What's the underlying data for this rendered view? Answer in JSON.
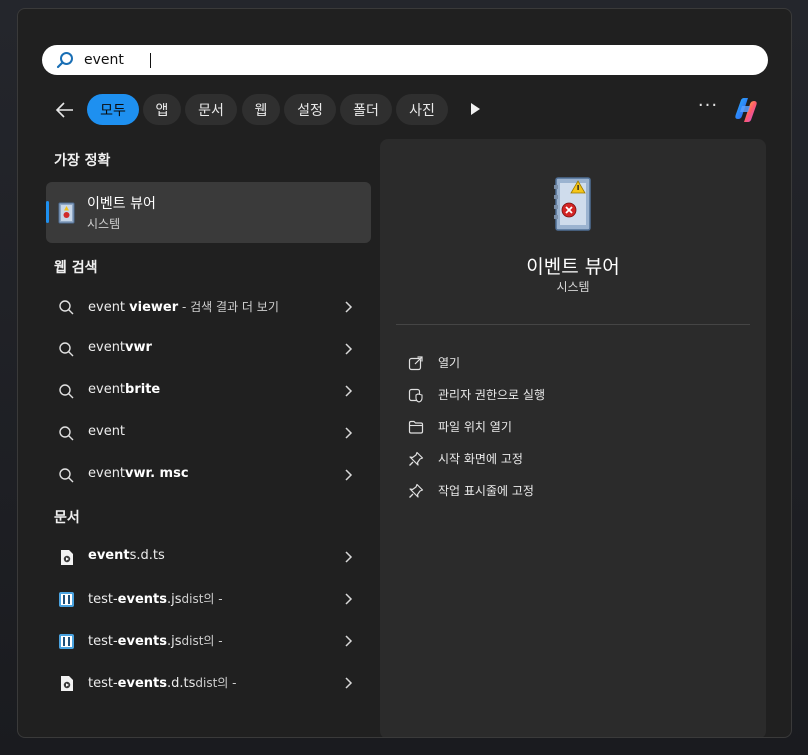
{
  "search": {
    "value": "event"
  },
  "filters": [
    {
      "label": "모두",
      "active": true
    },
    {
      "label": "앱"
    },
    {
      "label": "문서"
    },
    {
      "label": "웹"
    },
    {
      "label": "설정"
    },
    {
      "label": "폴더"
    },
    {
      "label": "사진"
    }
  ],
  "more_label": "···",
  "sections": {
    "best_match": "가장 정확",
    "web": "웹 검색",
    "docs": "문서"
  },
  "best_match": {
    "name": "이벤트 뷰어",
    "subtitle": "시스템"
  },
  "web_results": [
    {
      "plain": "event ",
      "bold": "viewer",
      "suffix": " - 검색 결과 더 보기"
    },
    {
      "plain": "event",
      "bold": "vwr",
      "suffix": ""
    },
    {
      "plain": "event",
      "bold": "brite",
      "suffix": ""
    },
    {
      "plain": "event",
      "bold": "",
      "suffix": ""
    },
    {
      "plain": "event",
      "bold": "vwr. msc",
      "suffix": ""
    }
  ],
  "doc_results": [
    {
      "pre": "",
      "bold": "event",
      "post": "s.d.ts",
      "suffix": "",
      "icon": "ts-file-icon"
    },
    {
      "pre": "test-",
      "bold": "events",
      "post": ".js",
      "suffix": "dist의 -",
      "icon": "js-file-icon"
    },
    {
      "pre": "test-",
      "bold": "events",
      "post": ".js",
      "suffix": "dist의 -",
      "icon": "js-file-icon"
    },
    {
      "pre": "test-",
      "bold": "events",
      "post": ".d.ts",
      "suffix": "dist의 -",
      "icon": "ts-file-icon"
    }
  ],
  "preview": {
    "title": "이벤트 뷰어",
    "subtitle": "시스템",
    "actions": [
      {
        "label": "열기",
        "icon": "open-icon"
      },
      {
        "label": "관리자 권한으로 실행",
        "icon": "admin-shield-icon"
      },
      {
        "label": "파일 위치 열기",
        "icon": "folder-icon"
      },
      {
        "label": "시작 화면에 고정",
        "icon": "pin-icon"
      },
      {
        "label": "작업 표시줄에 고정",
        "icon": "pin-icon"
      }
    ]
  },
  "colors": {
    "accent": "#1e90f0",
    "panel": "#202020",
    "preview": "#2b2b2b",
    "chip": "#2f2f2f"
  }
}
